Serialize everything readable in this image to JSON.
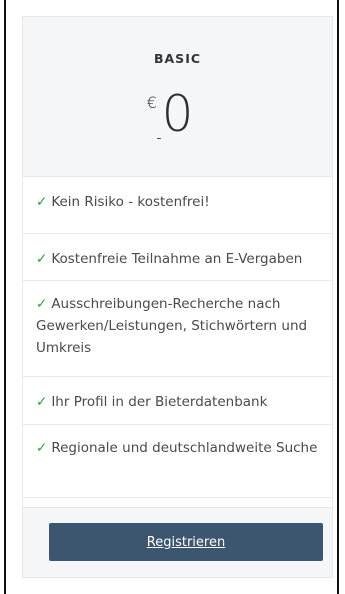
{
  "plan": {
    "name": "BASIC",
    "currency": "€",
    "price": "0"
  },
  "features": [
    {
      "check": "✓",
      "text": "Kein Risiko - kostenfrei!"
    },
    {
      "check": "✓",
      "text": "Kostenfreie Teilnahme an E-Vergaben"
    },
    {
      "check": "✓",
      "text": "Ausschreibungen-Recherche nach Gewerken/Leistungen, Stichwörtern und Umkreis"
    },
    {
      "check": "✓",
      "text": "Ihr Profil in der Bieterdatenbank"
    },
    {
      "check": "✓",
      "text": "Regionale und deutschlandweite Suche"
    }
  ],
  "footer": {
    "register_label": "Registrieren"
  },
  "colors": {
    "accent_button": "#3c5670",
    "check_green": "#27a43b",
    "header_bg": "#f4f6f7"
  }
}
